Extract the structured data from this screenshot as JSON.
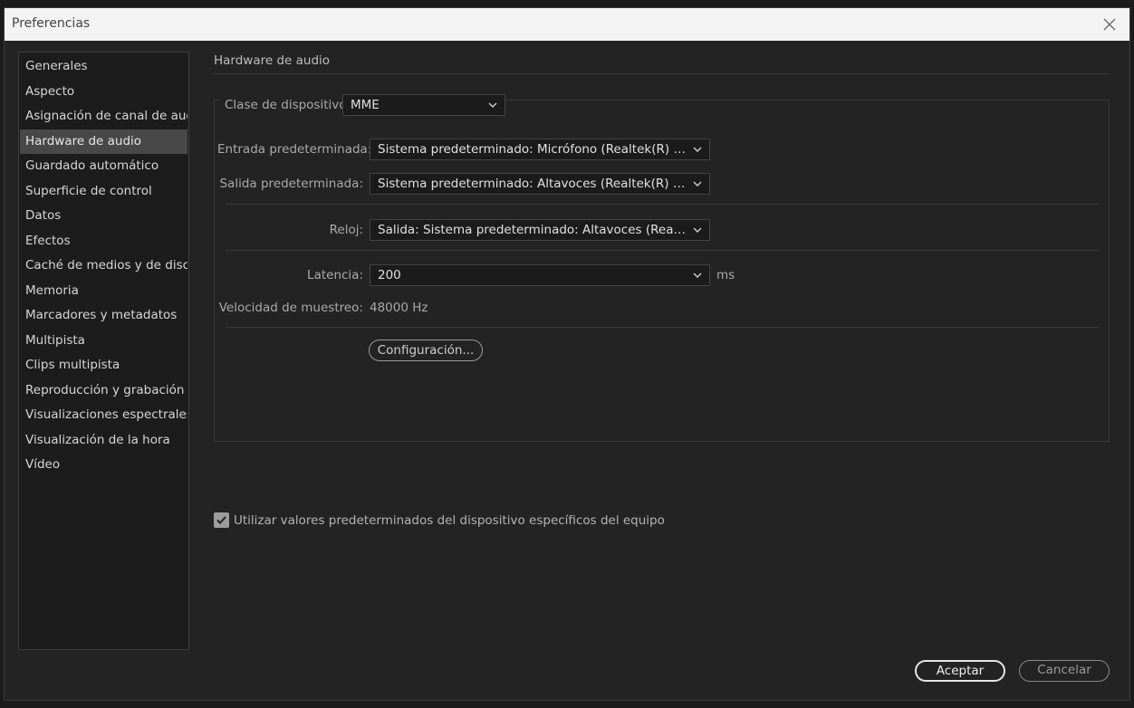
{
  "window": {
    "title": "Preferencias"
  },
  "sidebar": {
    "items": [
      {
        "label": "Generales"
      },
      {
        "label": "Aspecto"
      },
      {
        "label": "Asignación de canal de audio"
      },
      {
        "label": "Hardware de audio",
        "active": true
      },
      {
        "label": "Guardado automático"
      },
      {
        "label": "Superficie de control"
      },
      {
        "label": "Datos"
      },
      {
        "label": "Efectos"
      },
      {
        "label": "Caché de medios y de disco"
      },
      {
        "label": "Memoria"
      },
      {
        "label": "Marcadores y metadatos"
      },
      {
        "label": "Multipista"
      },
      {
        "label": "Clips multipista"
      },
      {
        "label": "Reproducción y grabación"
      },
      {
        "label": "Visualizaciones espectrales"
      },
      {
        "label": "Visualización de la hora"
      },
      {
        "label": "Vídeo"
      }
    ]
  },
  "main": {
    "section_title": "Hardware de audio",
    "device_class": {
      "label": "Clase de dispositivo:",
      "value": "MME"
    },
    "default_input": {
      "label": "Entrada predeterminada:",
      "value": "Sistema predeterminado: Micrófono (Realtek(R) Audio)"
    },
    "default_output": {
      "label": "Salida predeterminada:",
      "value": "Sistema predeterminado: Altavoces (Realtek(R) Audio)"
    },
    "clock": {
      "label": "Reloj:",
      "value": "Salida: Sistema predeterminado: Altavoces (Realtek(R)..."
    },
    "latency": {
      "label": "Latencia:",
      "value": "200",
      "unit": "ms"
    },
    "sample_rate": {
      "label": "Velocidad de muestreo:",
      "value": "48000 Hz"
    },
    "settings_button": "Configuración...",
    "use_defaults": {
      "label": "Utilizar valores predeterminados del dispositivo específicos del equipo",
      "checked": true
    }
  },
  "footer": {
    "ok": "Aceptar",
    "cancel": "Cancelar"
  },
  "colors": {
    "active_item": "#484848",
    "background": "#232323",
    "titlebar": "#f3f3f3"
  }
}
